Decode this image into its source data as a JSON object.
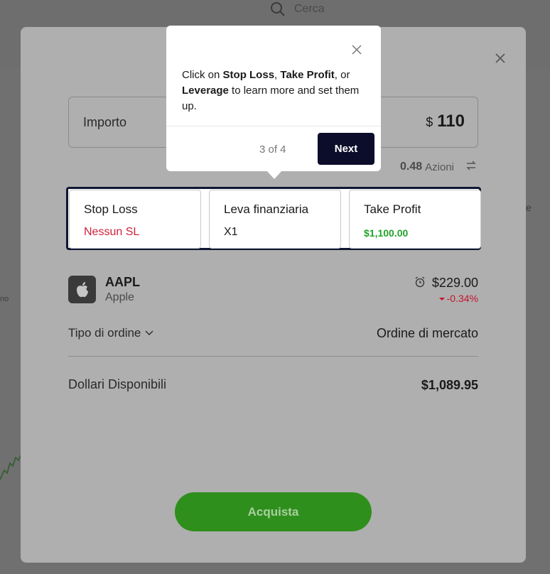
{
  "background": {
    "search_placeholder": "Cerca",
    "side_right_text": "e",
    "side_left_text": "no"
  },
  "modal": {
    "amount": {
      "label": "Importo",
      "currency": "$",
      "value": "110"
    },
    "shares": {
      "value": "0.48",
      "unit": "Azioni"
    },
    "options": [
      {
        "title": "Stop Loss",
        "value": "Nessun SL"
      },
      {
        "title": "Leva finanziaria",
        "value": "X1"
      },
      {
        "title": "Take Profit",
        "value": "$1,100.00"
      }
    ],
    "asset": {
      "ticker": "AAPL",
      "name": "Apple",
      "price": "$229.00",
      "change": "-0.34%"
    },
    "order": {
      "label": "Tipo di ordine",
      "value": "Ordine di mercato"
    },
    "available": {
      "label": "Dollari Disponibili",
      "value": "$1,089.95"
    },
    "buy_label": "Acquista"
  },
  "tooltip": {
    "text_parts": [
      "Click on ",
      "Stop Loss",
      ", ",
      "Take Profit",
      ", or ",
      "Leverage",
      " to learn more and set them up."
    ],
    "step": "3 of 4",
    "next_label": "Next"
  },
  "colors": {
    "primary_dark": "#0b0d2a",
    "buy_green": "#2f8f1c",
    "negative_red": "#d0213a",
    "positive_green": "#22a32a"
  }
}
